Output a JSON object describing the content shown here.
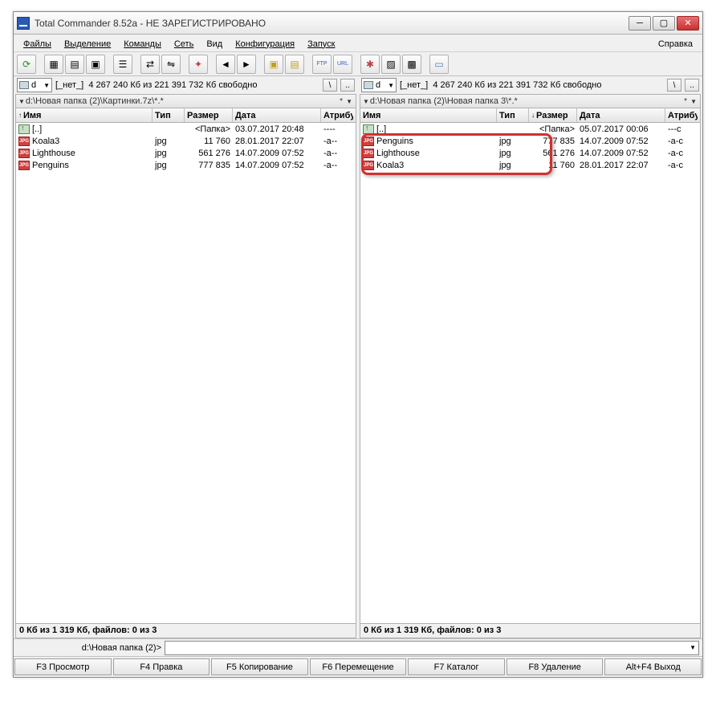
{
  "title": "Total Commander 8.52a - НЕ ЗАРЕГИСТРИРОВАНО",
  "menu": {
    "files": "Файлы",
    "selection": "Выделение",
    "commands": "Команды",
    "net": "Сеть",
    "view": "Вид",
    "config": "Конфигурация",
    "run": "Запуск",
    "help": "Справка"
  },
  "drive": {
    "label": "d",
    "none": "[_нет_]",
    "space": "4 267 240 Кб из 221 391 732 Кб свободно"
  },
  "nav": {
    "root": "\\",
    "up": "..",
    "star": "*"
  },
  "left": {
    "path": "d:\\Новая папка (2)\\Картинки.7z\\*.*",
    "cols": {
      "name": "Имя",
      "type": "Тип",
      "size": "Размер",
      "date": "Дата",
      "attr": "Атрибу"
    },
    "sort_arrow": "↑",
    "rows": [
      {
        "icon": "up",
        "name": "[..]",
        "type": "",
        "size": "<Папка>",
        "date": "03.07.2017 20:48",
        "attr": "----"
      },
      {
        "icon": "jpg",
        "name": "Koala3",
        "type": "jpg",
        "size": "11 760",
        "date": "28.01.2017 22:07",
        "attr": "-a--"
      },
      {
        "icon": "jpg",
        "name": "Lighthouse",
        "type": "jpg",
        "size": "561 276",
        "date": "14.07.2009 07:52",
        "attr": "-a--"
      },
      {
        "icon": "jpg",
        "name": "Penguins",
        "type": "jpg",
        "size": "777 835",
        "date": "14.07.2009 07:52",
        "attr": "-a--"
      }
    ],
    "status": "0 Кб из 1 319 Кб, файлов: 0 из 3"
  },
  "right": {
    "path": "d:\\Новая папка (2)\\Новая папка 3\\*.*",
    "cols": {
      "name": "Имя",
      "type": "Тип",
      "size": "Размер",
      "date": "Дата",
      "attr": "Атрибу"
    },
    "sort_arrow": "↓",
    "rows": [
      {
        "icon": "up",
        "name": "[..]",
        "type": "",
        "size": "<Папка>",
        "date": "05.07.2017 00:06",
        "attr": "---c"
      },
      {
        "icon": "jpg",
        "name": "Penguins",
        "type": "jpg",
        "size": "777 835",
        "date": "14.07.2009 07:52",
        "attr": "-a-c"
      },
      {
        "icon": "jpg",
        "name": "Lighthouse",
        "type": "jpg",
        "size": "561 276",
        "date": "14.07.2009 07:52",
        "attr": "-a-c"
      },
      {
        "icon": "jpg",
        "name": "Koala3",
        "type": "jpg",
        "size": "11 760",
        "date": "28.01.2017 22:07",
        "attr": "-a-c"
      }
    ],
    "status": "0 Кб из 1 319 Кб, файлов: 0 из 3"
  },
  "cmd": {
    "path": "d:\\Новая папка (2)>"
  },
  "fkeys": {
    "f3": "F3 Просмотр",
    "f4": "F4 Правка",
    "f5": "F5 Копирование",
    "f6": "F6 Перемещение",
    "f7": "F7 Каталог",
    "f8": "F8 Удаление",
    "altf4": "Alt+F4 Выход"
  },
  "jpg_label": "JPG"
}
